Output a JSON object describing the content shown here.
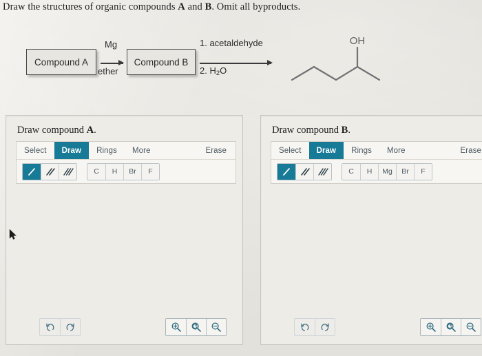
{
  "prompt": {
    "text_before": "Draw the structures of organic compounds ",
    "label_a": "A",
    "text_mid": " and ",
    "label_b": "B",
    "text_after": ". Omit all byproducts."
  },
  "scheme": {
    "compound_a_box": "Compound A",
    "compound_b_box": "Compound B",
    "arrow1": {
      "above": "Mg",
      "below": "ether"
    },
    "arrow2": {
      "above": "1. acetaldehyde",
      "below_prefix": "2. H",
      "below_sub": "2",
      "below_suffix": "O"
    },
    "product": {
      "name": "2-pentanol",
      "oh_label": "OH",
      "bond_color": "#6f7274"
    }
  },
  "panels": [
    {
      "id": "a",
      "title_prefix": "Draw compound ",
      "title_letter": "A",
      "title_suffix": ".",
      "tabs": [
        {
          "label": "Select",
          "active": false
        },
        {
          "label": "Draw",
          "active": true
        },
        {
          "label": "Rings",
          "active": false
        },
        {
          "label": "More",
          "active": false
        }
      ],
      "erase_label": "Erase",
      "bond_tools": [
        {
          "name": "single-bond",
          "order": 1,
          "active": true
        },
        {
          "name": "double-bond",
          "order": 2,
          "active": false
        },
        {
          "name": "triple-bond",
          "order": 3,
          "active": false
        }
      ],
      "elements": [
        "C",
        "H",
        "Br",
        "F"
      ],
      "history": [
        "undo",
        "redo"
      ],
      "zoom": [
        "zoom-in",
        "zoom-reset",
        "zoom-out"
      ]
    },
    {
      "id": "b",
      "title_prefix": "Draw compound ",
      "title_letter": "B",
      "title_suffix": ".",
      "tabs": [
        {
          "label": "Select",
          "active": false
        },
        {
          "label": "Draw",
          "active": true
        },
        {
          "label": "Rings",
          "active": false
        },
        {
          "label": "More",
          "active": false
        }
      ],
      "erase_label": "Erase",
      "bond_tools": [
        {
          "name": "single-bond",
          "order": 1,
          "active": true
        },
        {
          "name": "double-bond",
          "order": 2,
          "active": false
        },
        {
          "name": "triple-bond",
          "order": 3,
          "active": false
        }
      ],
      "elements": [
        "C",
        "H",
        "Mg",
        "Br",
        "F"
      ],
      "history": [
        "undo",
        "redo"
      ],
      "zoom": [
        "zoom-in",
        "zoom-reset",
        "zoom-out"
      ]
    }
  ],
  "colors": {
    "accent_teal": "#177a96",
    "page_bg": "#eceae5",
    "panel_bg": "#eeece7",
    "editor_bg": "#f7f6f3",
    "text": "#2b2b2b",
    "tab_text": "#4c5a62"
  }
}
